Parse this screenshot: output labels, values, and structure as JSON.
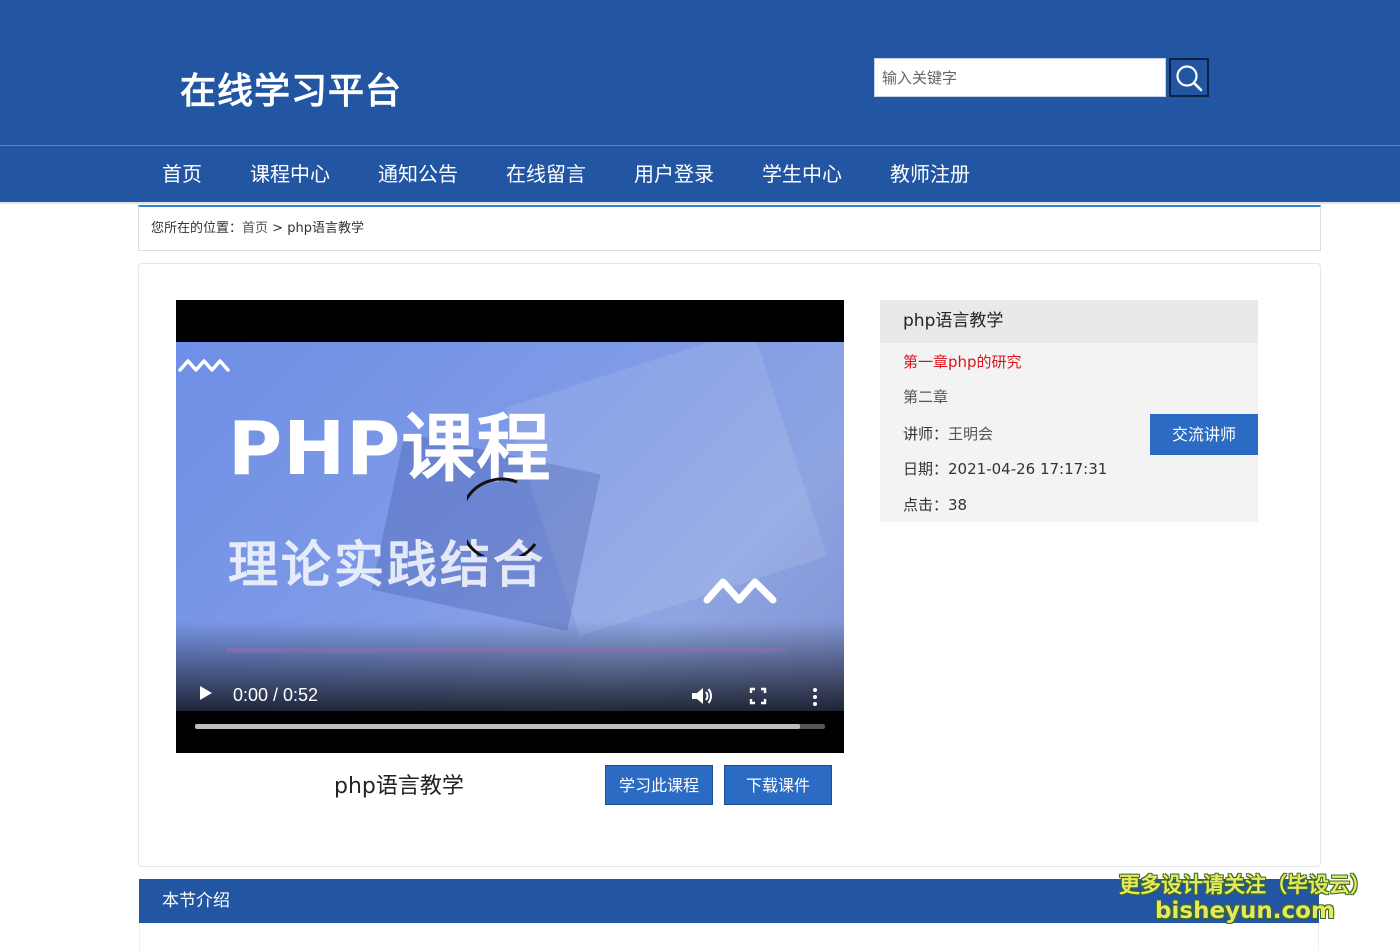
{
  "header": {
    "site_title": "在线学习平台",
    "search_placeholder": "输入关键字",
    "search_icon": "search-icon"
  },
  "nav": {
    "items": [
      {
        "label": "首页"
      },
      {
        "label": "课程中心"
      },
      {
        "label": "通知公告"
      },
      {
        "label": "在线留言"
      },
      {
        "label": "用户登录"
      },
      {
        "label": "学生中心"
      },
      {
        "label": "教师注册"
      }
    ]
  },
  "breadcrumb": {
    "prefix": "您所在的位置：",
    "home": "首页",
    "separator": " > ",
    "current": "php语言教学"
  },
  "video": {
    "heading": "PHP课程",
    "subheading": "理论实践结合",
    "time": "0:00 / 0:52",
    "progress_fraction": 0.96,
    "state": "loading",
    "icons": [
      "play-icon",
      "volume-icon",
      "fullscreen-icon",
      "more-options-icon",
      "loading-spinner-icon"
    ]
  },
  "course": {
    "title": "php语言教学",
    "study_button": "学习此课程",
    "download_button": "下载课件"
  },
  "info": {
    "title": "php语言教学",
    "chapters": [
      {
        "label": "第一章php的研究",
        "active": true
      },
      {
        "label": "第二章",
        "active": false
      }
    ],
    "teacher_label": "讲师：",
    "teacher": "王明会",
    "date_label": "日期：",
    "date": "2021-04-26 17:17:31",
    "clicks_label": "点击：",
    "clicks": "38",
    "contact_button": "交流讲师"
  },
  "section": {
    "title": "本节介绍"
  },
  "watermark": {
    "line1": "更多设计请关注（毕设云）",
    "line2": "bisheyun.com"
  },
  "colors": {
    "primary": "#2356a2",
    "button": "#2c6bc4",
    "active_chapter": "#d9151b",
    "breadcrumb_accent": "#2e88d0"
  }
}
